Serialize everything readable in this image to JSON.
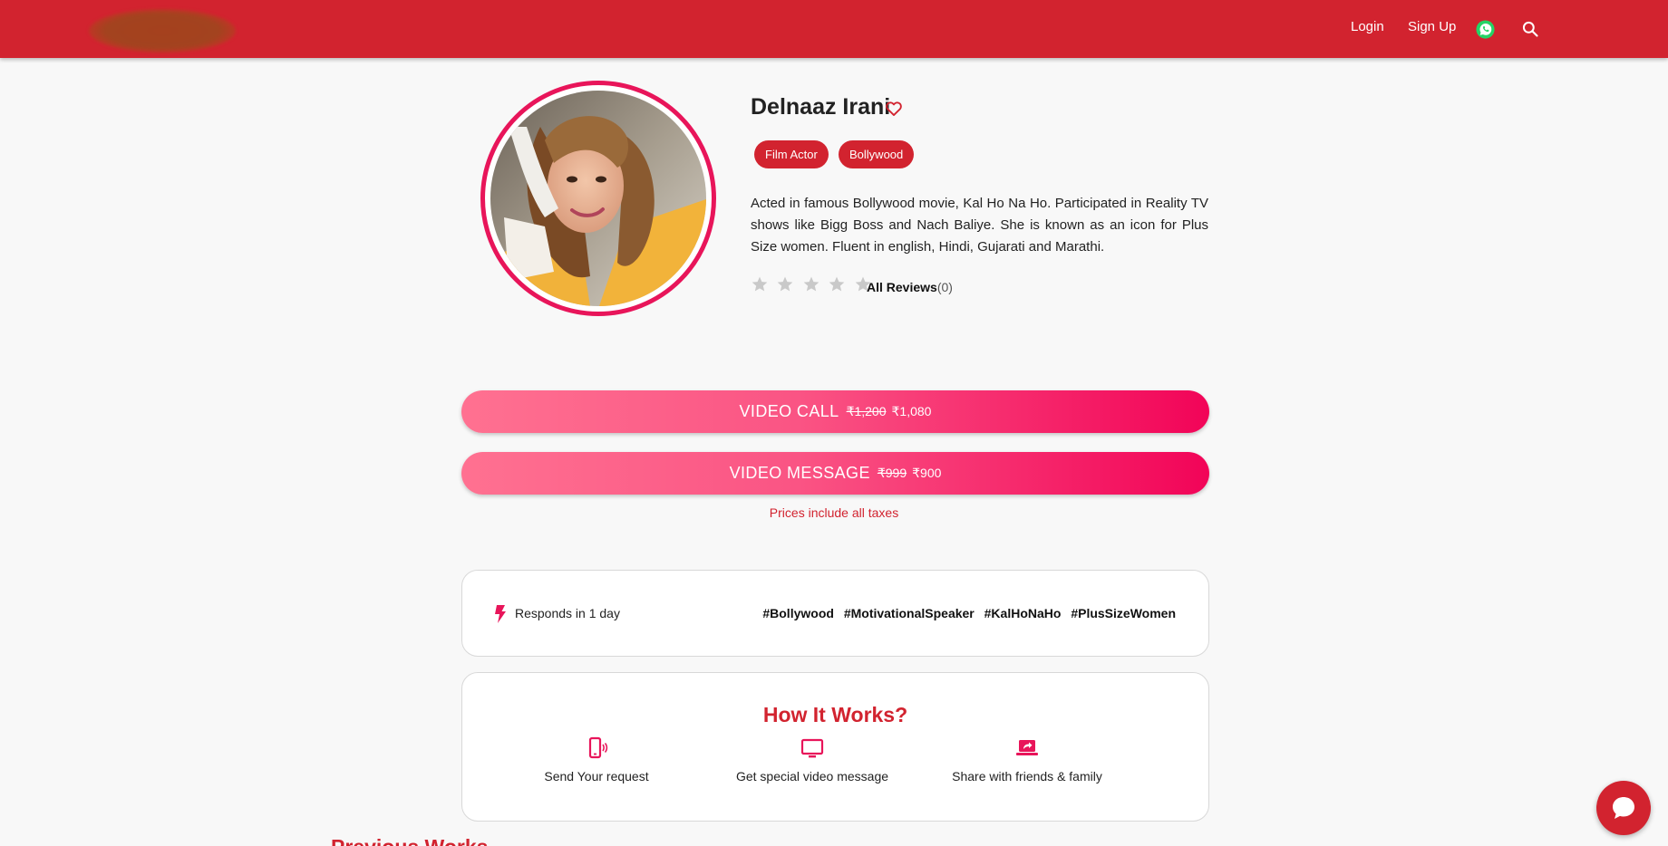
{
  "header": {
    "login_label": "Login",
    "signup_label": "Sign Up",
    "whatsapp_icon": "whatsapp-icon",
    "search_icon": "search-icon"
  },
  "profile": {
    "name": "Delnaaz Irani",
    "tags": [
      "Film Actor",
      "Bollywood"
    ],
    "bio": "Acted in famous Bollywood movie, Kal Ho Na Ho. Participated in Reality TV shows like Bigg Boss and Nach Baliye. She is known as an icon for Plus Size women. Fluent in english, Hindi, Gujarati and Marathi.",
    "rating": 0,
    "rating_max": 5,
    "reviews_label": "All Reviews",
    "reviews_count": "(0)"
  },
  "offers": [
    {
      "label": "VIDEO CALL",
      "old_price": "₹1,200",
      "new_price": "₹1,080"
    },
    {
      "label": "VIDEO MESSAGE",
      "old_price": "₹999",
      "new_price": "₹900"
    }
  ],
  "taxes_note": "Prices include all taxes",
  "response": {
    "text": "Responds in 1 day",
    "hashtags": [
      "#Bollywood",
      "#MotivationalSpeaker",
      "#KalHoNaHo",
      "#PlusSizeWomen"
    ]
  },
  "how_it_works": {
    "title": "How It Works?",
    "steps": [
      {
        "icon": "phone-vibrate-icon",
        "text": "Send Your request"
      },
      {
        "icon": "monitor-icon",
        "text": "Get special video message"
      },
      {
        "icon": "laptop-share-icon",
        "text": "Share with friends & family"
      }
    ]
  },
  "previous_works_title": "Previous Works",
  "colors": {
    "brand_red": "#d2232f",
    "accent_pink": "#e8155a",
    "cta_gradient_start": "#ff7191",
    "cta_gradient_end": "#f20458"
  }
}
